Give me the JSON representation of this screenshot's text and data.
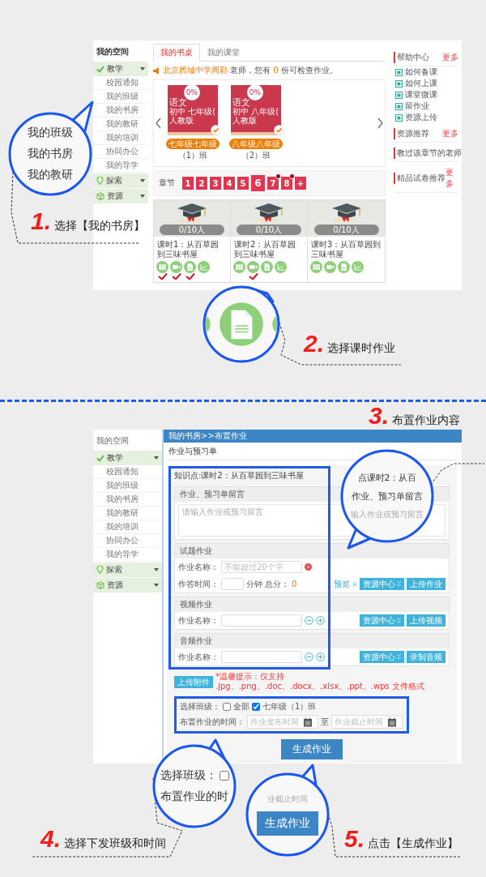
{
  "screen1": {
    "sidebar": {
      "title": "我的空间",
      "groups": [
        {
          "label": "教学",
          "children": [
            "校园通知",
            "我的班级",
            "我的书房",
            "我的教研",
            "我的培训",
            "协同办公",
            "我的导学"
          ]
        },
        {
          "label": "探索"
        },
        {
          "label": "资源"
        }
      ]
    },
    "tabs": [
      {
        "label": "我的书桌",
        "selected": true
      },
      {
        "label": "我的课堂",
        "selected": false
      }
    ],
    "notice": [
      {
        "text": "北京西城中学周勤",
        "highlight": true
      },
      {
        "text": " 老师，您有 ",
        "highlight": false
      },
      {
        "text": "0",
        "highlight": true
      },
      {
        "text": " 份可检查作业。",
        "highlight": false
      }
    ],
    "books": [
      {
        "percent": "0%",
        "subject": "语文",
        "grade": "初中 七年级(",
        "publisher": "人教版",
        "checked": true,
        "class_tag": "七年级七年级",
        "class_name": "（1）班"
      },
      {
        "percent": "0%",
        "subject": "语文",
        "grade": "初中 八年级(",
        "publisher": "人教版",
        "checked": true,
        "class_tag": "八年级八年级",
        "class_name": "（2）班"
      }
    ],
    "chapters": {
      "label": "章节",
      "items": [
        {
          "label": "1",
          "selected": false,
          "badge": false
        },
        {
          "label": "2",
          "selected": false,
          "badge": false
        },
        {
          "label": "3",
          "selected": false,
          "badge": false
        },
        {
          "label": "4",
          "selected": false,
          "badge": false
        },
        {
          "label": "5",
          "selected": false,
          "badge": false
        },
        {
          "label": "6",
          "selected": true,
          "badge": false
        },
        {
          "label": "7",
          "selected": false,
          "badge": true
        },
        {
          "label": "8",
          "selected": false,
          "badge": true
        },
        {
          "label": "+",
          "selected": false,
          "badge": false
        }
      ]
    },
    "lessons": [
      {
        "progress": "0/10人",
        "title": "课时1：从百草园到三味书屋",
        "actions": [
          {
            "kind": "books",
            "done": true
          },
          {
            "kind": "video",
            "done": true
          },
          {
            "kind": "doc",
            "done": true
          },
          {
            "kind": "chart",
            "done": false
          }
        ]
      },
      {
        "progress": "0/10人",
        "title": "课时2：从百草园到三味书屋",
        "actions": [
          {
            "kind": "books",
            "done": false
          },
          {
            "kind": "video",
            "done": true
          },
          {
            "kind": "doc",
            "done": false
          },
          {
            "kind": "chart",
            "done": false
          }
        ]
      },
      {
        "progress": "0/10人",
        "title": "课时3：从百草园到三味书屋",
        "actions": [
          {
            "kind": "books",
            "done": false
          },
          {
            "kind": "video",
            "done": false
          },
          {
            "kind": "doc",
            "done": false
          },
          {
            "kind": "chart",
            "done": false
          }
        ]
      }
    ],
    "right": [
      {
        "title": "帮助中心",
        "more": "更多",
        "links": [
          "如何备课",
          "如何上课",
          "课堂微课",
          "留作业",
          "资源上传"
        ]
      },
      {
        "title": "资源推荐",
        "more": "更多"
      },
      {
        "title": "教过该章节的老师"
      },
      {
        "title": "精品试卷推荐",
        "more": "更多"
      }
    ]
  },
  "screen2": {
    "sidebar": {
      "title": "我的空间",
      "groups": [
        {
          "label": "教学",
          "children": [
            "校园通知",
            "我的班级",
            "我的书房",
            "我的教研",
            "我的培训",
            "协同办公",
            "我的导学"
          ]
        },
        {
          "label": "探索"
        },
        {
          "label": "资源"
        }
      ]
    },
    "breadcrumb": "我的书房>>布置作业",
    "title": "作业与预习单",
    "knowledge": "知识点:课时2：从百草园到三味书屋",
    "message": {
      "title": "作业、预习单留言",
      "placeholder": "请输入作业或预习留言"
    },
    "sections": [
      {
        "kind": "quiz",
        "title": "试题作业",
        "name_label": "作业名称：",
        "name_placeholder": "不能超过20个字",
        "time_label": "作答时间：",
        "time_unit": "分钟",
        "score_label": "总分：",
        "score": "0",
        "preview": "预览",
        "buttons": [
          "资源中心",
          "上传作业"
        ]
      },
      {
        "kind": "media",
        "title": "视频作业",
        "name_label": "作业名称：",
        "buttons": [
          "资源中心",
          "上传视频"
        ]
      },
      {
        "kind": "media",
        "title": "音频作业",
        "name_label": "作业名称：",
        "buttons": [
          "资源中心",
          "录制音频"
        ]
      }
    ],
    "upload": {
      "button": "上传附件",
      "tip": "*温馨提示：仅支持 .jpg、.png、.doc、.docx、.xlsx、.ppt、.wps 文件格式"
    },
    "classes": {
      "label": "选择班级：",
      "options": [
        {
          "label": "全部",
          "checked": false
        },
        {
          "label": "七年级（1）班",
          "checked": true
        }
      ]
    },
    "time": {
      "label": "布置作业的时间：",
      "start_placeholder": "作业发布时间",
      "separator": "至",
      "end_placeholder": "作业截止时间"
    },
    "submit": "生成作业"
  },
  "magnifiers": [
    {
      "items": [
        {
          "kind": "text",
          "text": "我的班级"
        },
        {
          "kind": "text",
          "text": "我的书房"
        },
        {
          "kind": "text",
          "text": "我的教研"
        }
      ]
    },
    {
      "items": [
        {
          "kind": "doc-icon"
        }
      ]
    },
    {
      "items": [
        {
          "kind": "text",
          "text": "点课时2：从百"
        },
        {
          "kind": "heading",
          "text": "作业、预习单留言"
        },
        {
          "kind": "hint",
          "text": "输入作业或预习留言"
        }
      ]
    },
    {
      "items": [
        {
          "kind": "checkbox",
          "text": "选择班级：",
          "checked": false
        },
        {
          "kind": "text",
          "text": "布置作业的时"
        }
      ]
    },
    {
      "items": [
        {
          "kind": "hint",
          "text": "业截止时间"
        },
        {
          "kind": "button",
          "text": "生成作业"
        }
      ]
    }
  ],
  "steps": [
    {
      "number": "1.",
      "text": "选择【我的书房】"
    },
    {
      "number": "2.",
      "text": "选择课时作业"
    },
    {
      "number": "3.",
      "text": "布置作业内容"
    },
    {
      "number": "4.",
      "text": "选择下发班级和时间"
    },
    {
      "number": "5.",
      "text": "点击【生成作业】"
    }
  ]
}
